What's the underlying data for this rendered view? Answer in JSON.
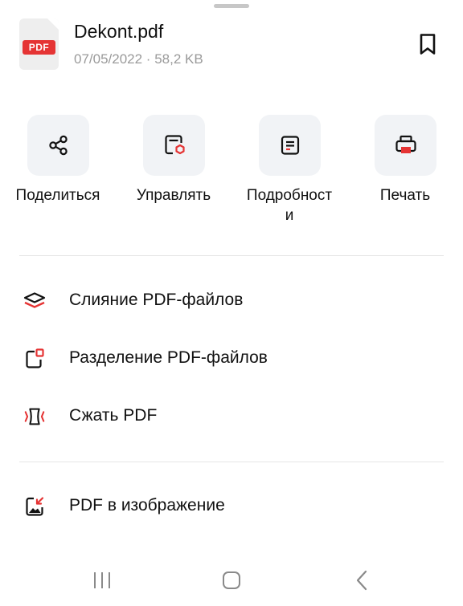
{
  "file": {
    "badge": "PDF",
    "name": "Dekont.pdf",
    "meta": "07/05/2022 · 58,2 KB"
  },
  "actions": [
    {
      "label": "Поделиться",
      "icon": "share-icon"
    },
    {
      "label": "Управлять",
      "icon": "manage-icon"
    },
    {
      "label": "Подробност\nи",
      "icon": "details-icon"
    },
    {
      "label": "Печать",
      "icon": "print-icon"
    }
  ],
  "menu": [
    {
      "label": "Слияние PDF-файлов",
      "icon": "merge-layers-icon"
    },
    {
      "label": "Разделение PDF-файлов",
      "icon": "split-icon"
    },
    {
      "label": "Сжать PDF",
      "icon": "compress-icon"
    },
    {
      "label": "PDF в изображение",
      "icon": "pdf-to-image-icon"
    }
  ],
  "nav": [
    "recent-apps-icon",
    "home-icon",
    "back-icon"
  ],
  "colors": {
    "accent": "#e53434",
    "tile": "#f1f3f6",
    "text": "#111111",
    "meta": "#9a9a9a"
  }
}
